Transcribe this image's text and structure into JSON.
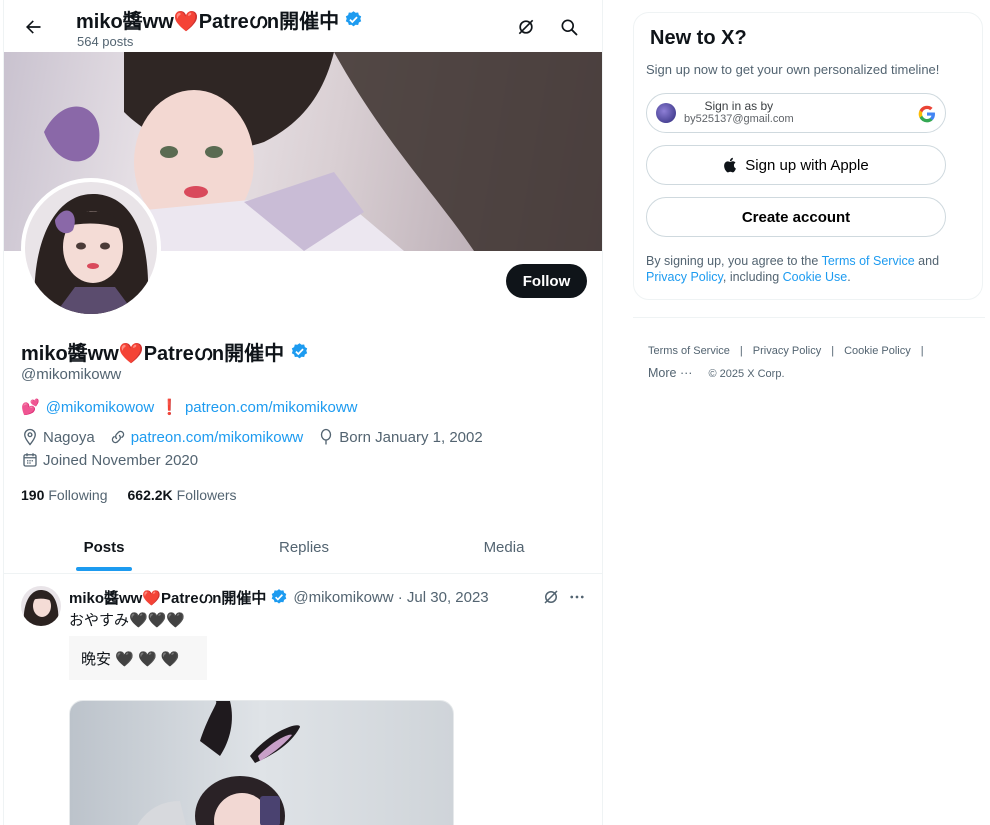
{
  "header": {
    "display_name": "miko醬ww❤️Patreഗn開催中",
    "post_count": "564 posts"
  },
  "profile": {
    "display_name": "miko醬ww❤️Patreഗn開催中",
    "handle": "@mikomikoww",
    "follow_label": "Follow",
    "bio": {
      "emoji1": "💕",
      "mention": "@mikomikowow",
      "emoji2": "❗",
      "link": "patreon.com/mikomikoww"
    },
    "location": "Nagoya",
    "website": "patreon.com/mikomikoww",
    "birthday": "Born January 1, 2002",
    "joined": "Joined November 2020",
    "following_count": "190",
    "following_label": "Following",
    "followers_count": "662.2K",
    "followers_label": "Followers"
  },
  "tabs": [
    {
      "label": "Posts",
      "active": true
    },
    {
      "label": "Replies",
      "active": false
    },
    {
      "label": "Media",
      "active": false
    }
  ],
  "tweet": {
    "author": "miko醬ww❤️Patreഗn開催中",
    "meta": "@mikomikoww · Jul 30, 2023",
    "text": "おやすみ🖤🖤🖤",
    "quote": "晩安 🖤 🖤 🖤"
  },
  "sidebar": {
    "title": "New to X?",
    "subtitle": "Sign up now to get your own personalized timeline!",
    "google_line1": "Sign in as by",
    "google_line2": "by525137@gmail.com",
    "apple_label": "Sign up with Apple",
    "create_label": "Create account",
    "terms_prefix": "By signing up, you agree to the ",
    "terms_link": "Terms of Service",
    "terms_and": " and ",
    "privacy_link": "Privacy Policy",
    "terms_including": ", including ",
    "cookie_link": "Cookie Use",
    "terms_end": "."
  },
  "footer": {
    "links": [
      "Terms of Service",
      "Privacy Policy",
      "Cookie Policy"
    ],
    "more": "More ···",
    "copyright": "© 2025 X Corp."
  },
  "colors": {
    "accent": "#1d9bf0",
    "text": "#0f1419",
    "muted": "#536471",
    "follow_button": "#0f1419"
  }
}
